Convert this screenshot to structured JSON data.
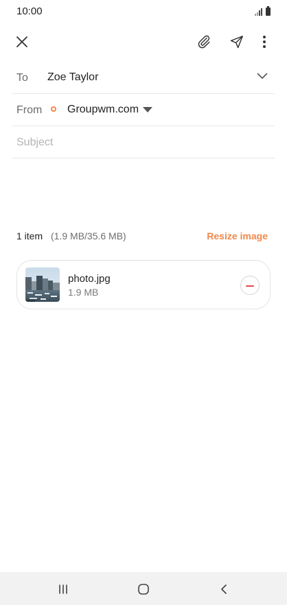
{
  "status_bar": {
    "time": "10:00",
    "icons": [
      "signal-icon",
      "battery-icon"
    ]
  },
  "toolbar": {
    "icons": [
      "close-icon",
      "attach-icon",
      "send-icon",
      "more-options-icon"
    ]
  },
  "compose": {
    "to_label": "To",
    "to_value": "Zoe Taylor",
    "from_label": "From",
    "from_value": "Groupwm.com",
    "subject_placeholder": "Subject",
    "subject_value": ""
  },
  "attachments": {
    "count_label": "1 item",
    "size_label": "(1.9 MB/35.6 MB)",
    "resize_label": "Resize image",
    "items": [
      {
        "name": "photo.jpg",
        "size": "1.9 MB"
      }
    ]
  },
  "nav_bar": {
    "icons": [
      "recent-apps-icon",
      "home-icon",
      "back-icon"
    ]
  },
  "colors": {
    "accent": "#f0884a",
    "remove": "#e04a4a",
    "divider": "#e7e7e7",
    "nav_background": "#f2f2f2"
  }
}
